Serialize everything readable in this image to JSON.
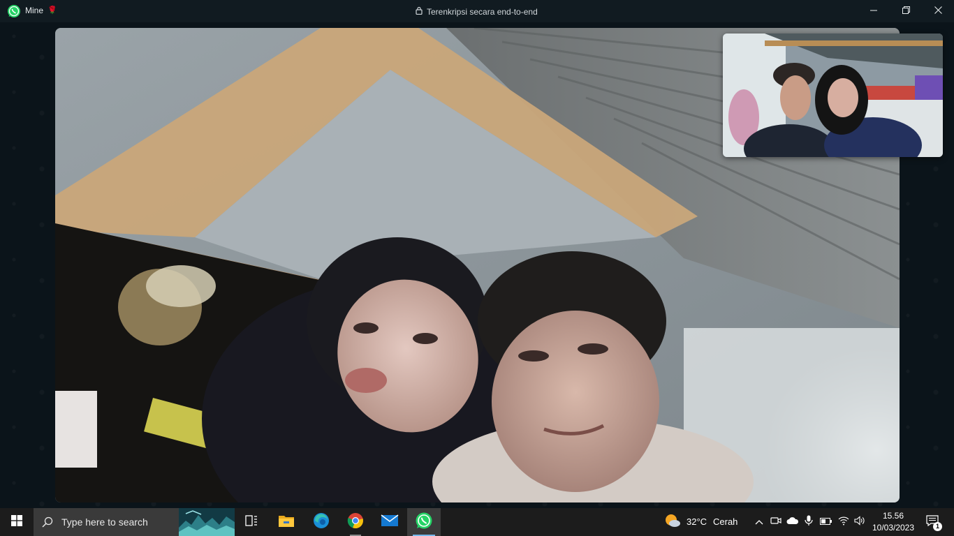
{
  "window": {
    "app_name": "Mine",
    "title_emoji": "🌹",
    "encryption_text": "Terenkripsi secara end-to-end",
    "icon": "whatsapp-icon"
  },
  "window_controls": {
    "minimize_icon": "minimize-icon",
    "restore_icon": "restore-icon",
    "close_icon": "close-icon"
  },
  "call": {
    "remote_video": "remote-video-feed",
    "self_video": "self-preview-feed"
  },
  "taskbar": {
    "search_placeholder": "Type here to search",
    "pinned_apps": [
      "task-view",
      "file-explorer",
      "edge",
      "chrome",
      "mail",
      "whatsapp"
    ],
    "weather": {
      "temp": "32°C",
      "desc": "Cerah"
    },
    "clock": {
      "time": "15.56",
      "date": "10/03/2023"
    },
    "notification_count": "1"
  },
  "colors": {
    "window_bg": "#111b21",
    "taskbar_bg": "#1c1c1c",
    "whatsapp_green": "#25d366",
    "accent_blue": "#76b9ed"
  }
}
